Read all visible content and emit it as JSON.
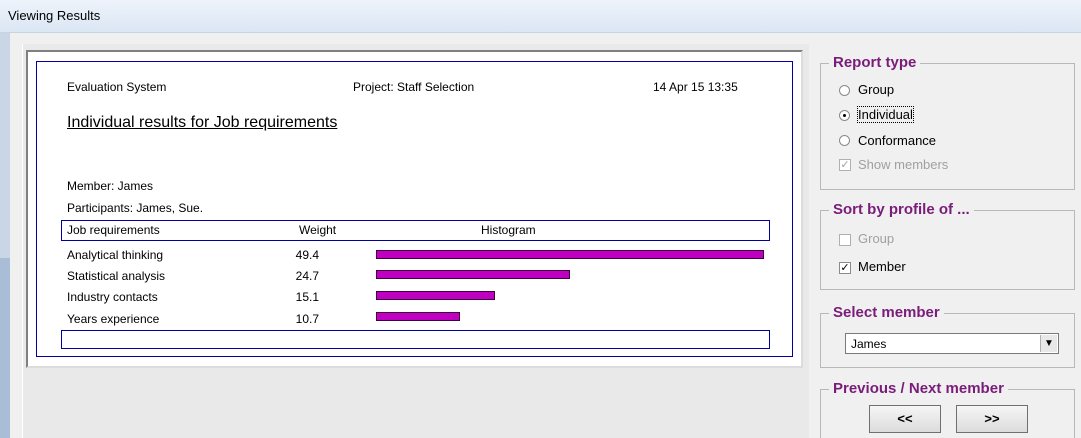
{
  "window": {
    "title": "Viewing Results"
  },
  "report": {
    "header_left": "Evaluation System",
    "header_center": "Project: Staff Selection",
    "header_right": "14 Apr 15  13:35",
    "title": "Individual results for Job requirements",
    "member_line": "Member: James",
    "participants_line": "Participants: James,  Sue.",
    "columns": {
      "requirement": "Job requirements",
      "weight": "Weight",
      "histogram": "Histogram"
    },
    "rows": [
      {
        "label": "Analytical thinking",
        "weight": "49.4",
        "value": 49.4
      },
      {
        "label": "Statistical analysis",
        "weight": "24.7",
        "value": 24.7
      },
      {
        "label": "Industry contacts",
        "weight": "15.1",
        "value": 15.1
      },
      {
        "label": "Years experience",
        "weight": "10.7",
        "value": 10.7
      }
    ],
    "bar_color": "#c000c0"
  },
  "report_type": {
    "legend": "Report type",
    "options": [
      {
        "label": "Group",
        "selected": false
      },
      {
        "label": "Individual",
        "selected": true
      },
      {
        "label": "Conformance",
        "selected": false
      }
    ],
    "show_members": {
      "label": "Show members",
      "checked": true,
      "disabled": true
    }
  },
  "sort_by": {
    "legend": "Sort by profile of ...",
    "group": {
      "label": "Group",
      "checked": false,
      "disabled": true
    },
    "member": {
      "label": "Member",
      "checked": true,
      "disabled": false
    }
  },
  "select_member": {
    "legend": "Select member",
    "value": "James"
  },
  "prev_next": {
    "legend": "Previous / Next member",
    "prev_label": "<<",
    "next_label": ">>"
  },
  "accent_color": "#7a1c7a"
}
